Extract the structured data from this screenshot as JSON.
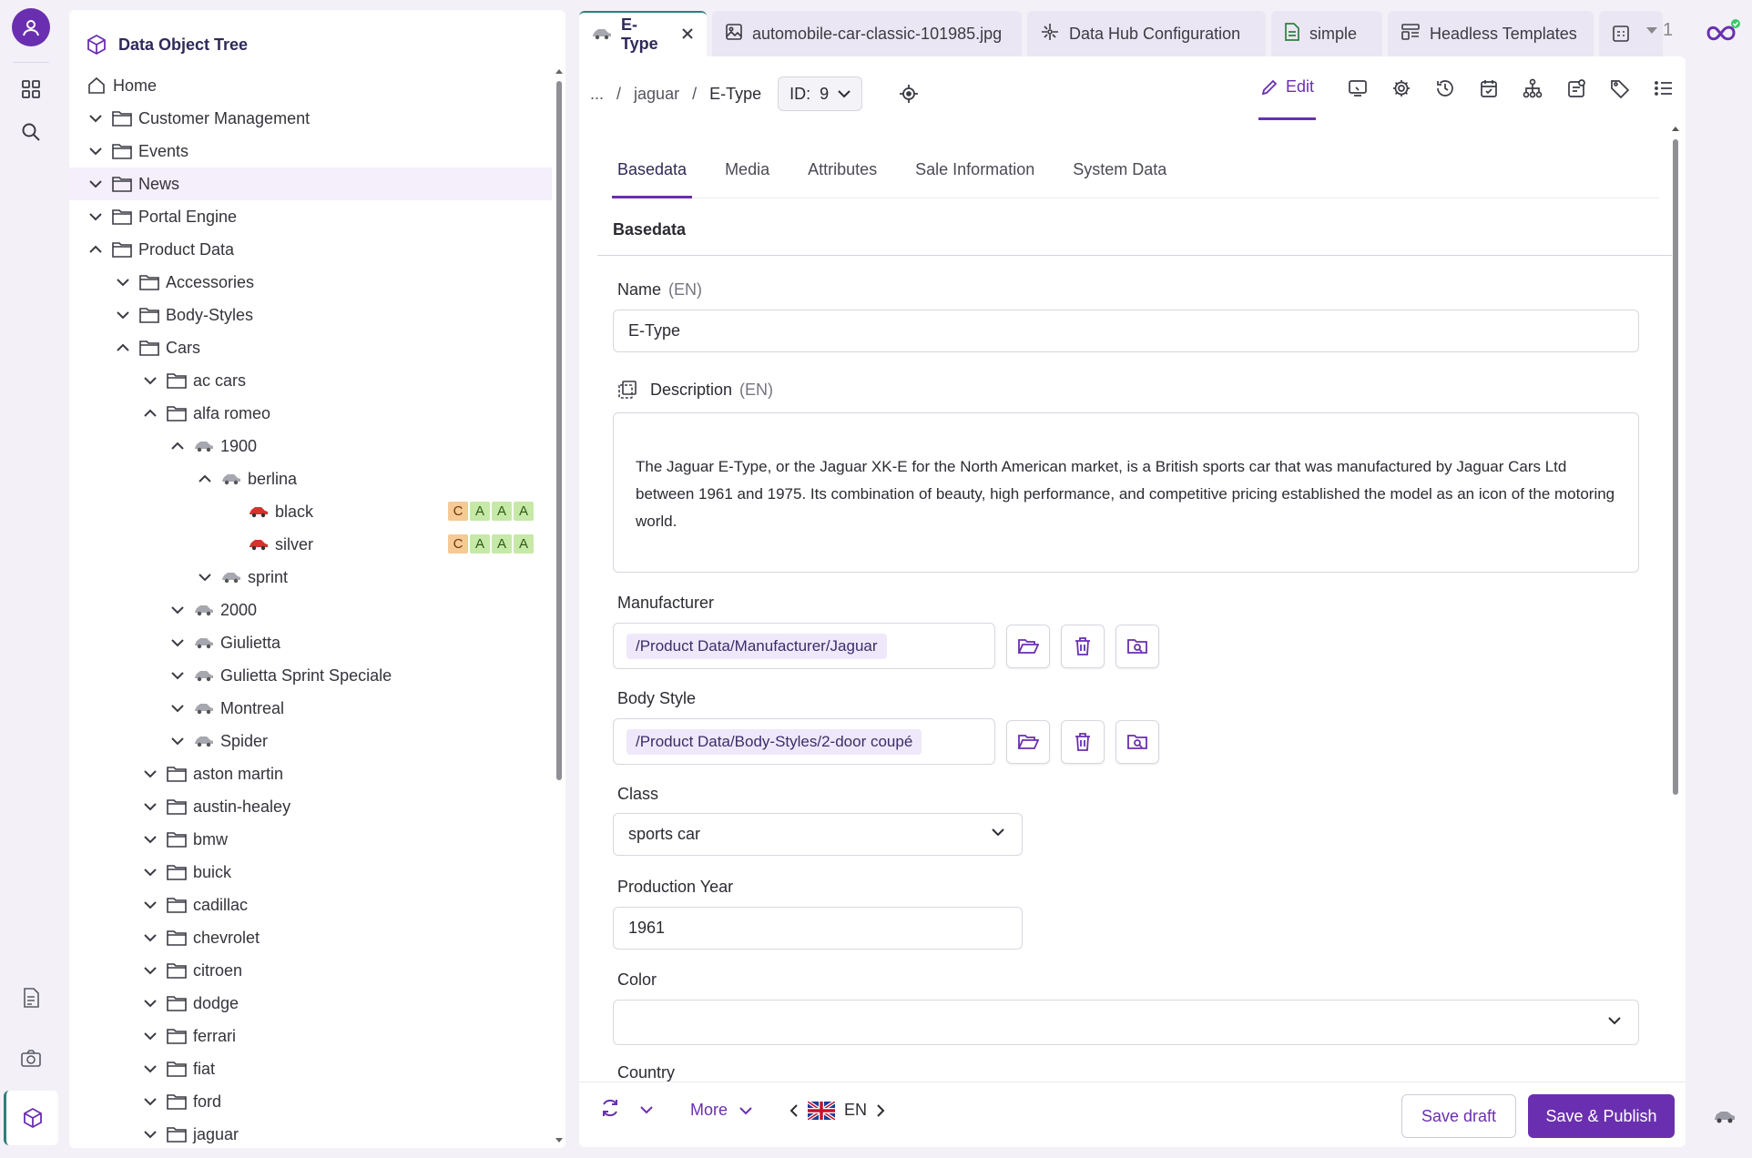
{
  "colors": {
    "accent": "#6a2fb0",
    "teal": "#2f7f7b",
    "badge_c": "#f6c995",
    "badge_a": "#c6e9a7"
  },
  "rail": {
    "items": [
      "user-avatar",
      "grid-icon",
      "search-icon",
      "document-icon",
      "camera-icon",
      "cube-icon"
    ]
  },
  "tree": {
    "title": "Data Object Tree",
    "rows": [
      {
        "label": "Home",
        "icon": "home-icon"
      },
      {
        "label": "Customer Management",
        "icon": "folder-icon"
      },
      {
        "label": "Events",
        "icon": "folder-icon"
      },
      {
        "label": "News",
        "icon": "folder-icon"
      },
      {
        "label": "Portal Engine",
        "icon": "folder-icon"
      },
      {
        "label": "Product Data",
        "icon": "folder-icon"
      },
      {
        "label": "Accessories",
        "icon": "folder-icon"
      },
      {
        "label": "Body-Styles",
        "icon": "folder-icon"
      },
      {
        "label": "Cars",
        "icon": "folder-icon"
      },
      {
        "label": "ac cars",
        "icon": "folder-icon"
      },
      {
        "label": "alfa romeo",
        "icon": "folder-icon"
      },
      {
        "label": "1900",
        "icon": "car-icon"
      },
      {
        "label": "berlina",
        "icon": "car-icon"
      },
      {
        "label": "black",
        "icon": "red-car-icon",
        "badges": [
          "C",
          "A",
          "A",
          "A"
        ]
      },
      {
        "label": "silver",
        "icon": "red-car-icon",
        "badges": [
          "C",
          "A",
          "A",
          "A"
        ]
      },
      {
        "label": "sprint",
        "icon": "car-icon"
      },
      {
        "label": "2000",
        "icon": "car-icon"
      },
      {
        "label": "Giulietta",
        "icon": "car-icon"
      },
      {
        "label": "Gulietta Sprint Speciale",
        "icon": "car-icon"
      },
      {
        "label": "Montreal",
        "icon": "car-icon"
      },
      {
        "label": "Spider",
        "icon": "car-icon"
      },
      {
        "label": "aston martin",
        "icon": "folder-icon"
      },
      {
        "label": "austin-healey",
        "icon": "folder-icon"
      },
      {
        "label": "bmw",
        "icon": "folder-icon"
      },
      {
        "label": "buick",
        "icon": "folder-icon"
      },
      {
        "label": "cadillac",
        "icon": "folder-icon"
      },
      {
        "label": "chevrolet",
        "icon": "folder-icon"
      },
      {
        "label": "citroen",
        "icon": "folder-icon"
      },
      {
        "label": "dodge",
        "icon": "folder-icon"
      },
      {
        "label": "ferrari",
        "icon": "folder-icon"
      },
      {
        "label": "fiat",
        "icon": "folder-icon"
      },
      {
        "label": "ford",
        "icon": "folder-icon"
      },
      {
        "label": "jaguar",
        "icon": "folder-icon"
      }
    ]
  },
  "tabs": [
    {
      "label": "E-Type",
      "icon": "car-icon",
      "active": true
    },
    {
      "label": "automobile-car-classic-101985.jpg",
      "icon": "image-icon"
    },
    {
      "label": "Data Hub Configuration",
      "icon": "datahub-icon"
    },
    {
      "label": "simple",
      "icon": "document-icon"
    },
    {
      "label": "Headless Templates",
      "icon": "template-icon"
    }
  ],
  "tab_overflow_count": "1",
  "breadcrumb": {
    "ellipsis": "...",
    "parent": "jaguar",
    "current": "E-Type",
    "id_label": "ID:",
    "id_value": "9"
  },
  "toolbar": {
    "edit_label": "Edit"
  },
  "inner_tabs": [
    "Basedata",
    "Media",
    "Attributes",
    "Sale Information",
    "System Data"
  ],
  "section_title": "Basedata",
  "fields": {
    "name": {
      "label": "Name",
      "lang": "(EN)",
      "value": "E-Type"
    },
    "description": {
      "label": "Description",
      "lang": "(EN)",
      "value": "The Jaguar E-Type, or the Jaguar XK-E for the North American market, is a British sports car that was manufactured by Jaguar Cars Ltd between 1961 and 1975. Its combination of beauty, high performance, and competitive pricing established the model as an icon of the motoring world."
    },
    "manufacturer": {
      "label": "Manufacturer",
      "value": "/Product Data/Manufacturer/Jaguar"
    },
    "body_style": {
      "label": "Body Style",
      "value": "/Product Data/Body-Styles/2-door coupé"
    },
    "class": {
      "label": "Class",
      "value": "sports car"
    },
    "production_year": {
      "label": "Production Year",
      "value": "1961"
    },
    "color": {
      "label": "Color",
      "value": ""
    },
    "country": {
      "label": "Country"
    }
  },
  "footer": {
    "more_label": "More",
    "lang": "EN",
    "save_draft": "Save draft",
    "save_publish": "Save & Publish"
  }
}
